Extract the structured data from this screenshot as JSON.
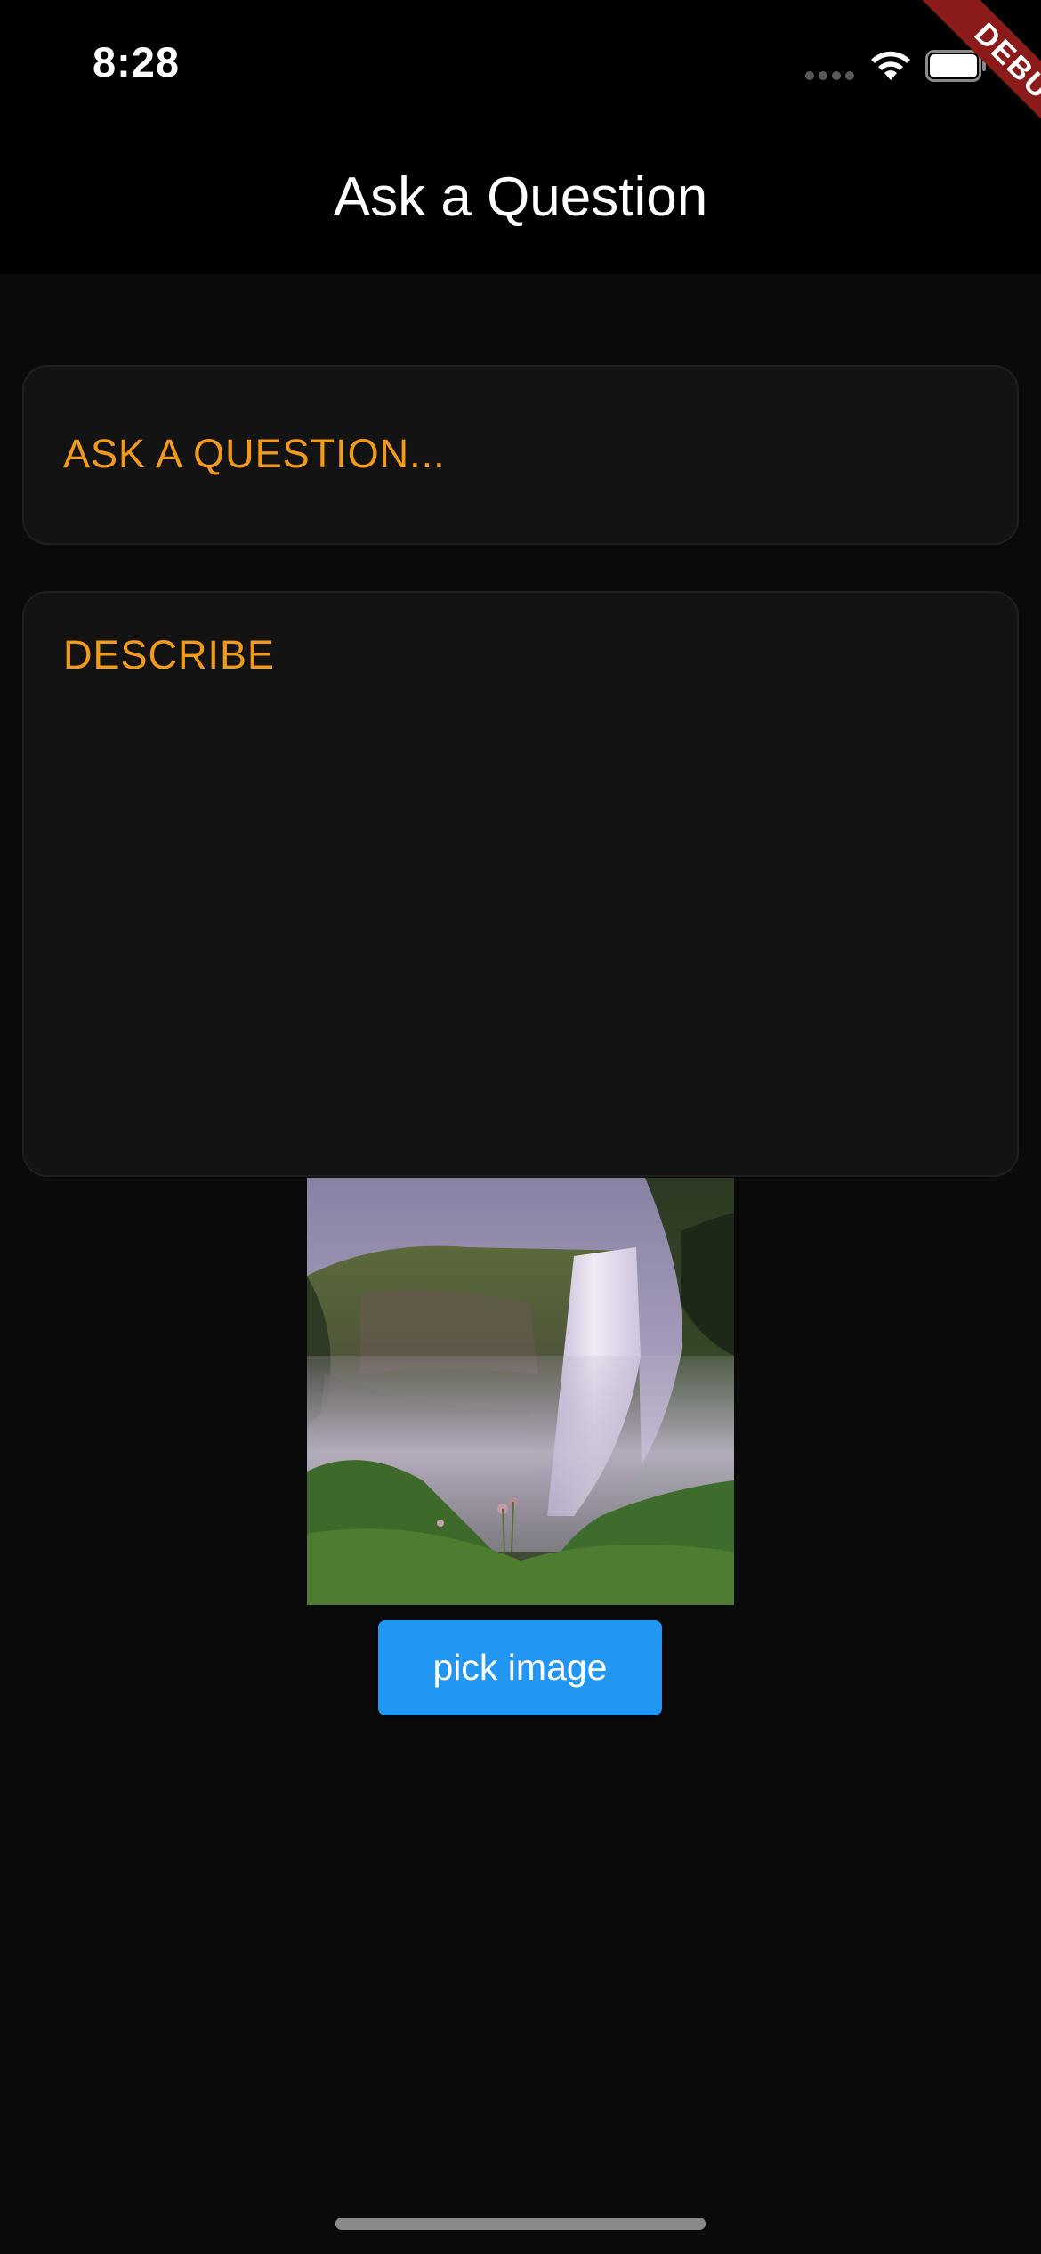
{
  "status_bar": {
    "time": "8:28",
    "wifi_icon": "wifi-icon",
    "battery_icon": "battery-icon",
    "signal_icon": "cellular-signal-dots"
  },
  "debug_banner": {
    "label": "DEBUG",
    "color": "#8b1a1a"
  },
  "app_bar": {
    "title": "Ask a Question"
  },
  "form": {
    "question_placeholder": "ASK A QUESTION...",
    "describe_placeholder": "DESCRIBE",
    "placeholder_color": "#f29a1b"
  },
  "image": {
    "alt": "waterfall photo",
    "icon": "picked-image"
  },
  "actions": {
    "pick_image_label": "pick image",
    "button_color": "#2196f3"
  }
}
